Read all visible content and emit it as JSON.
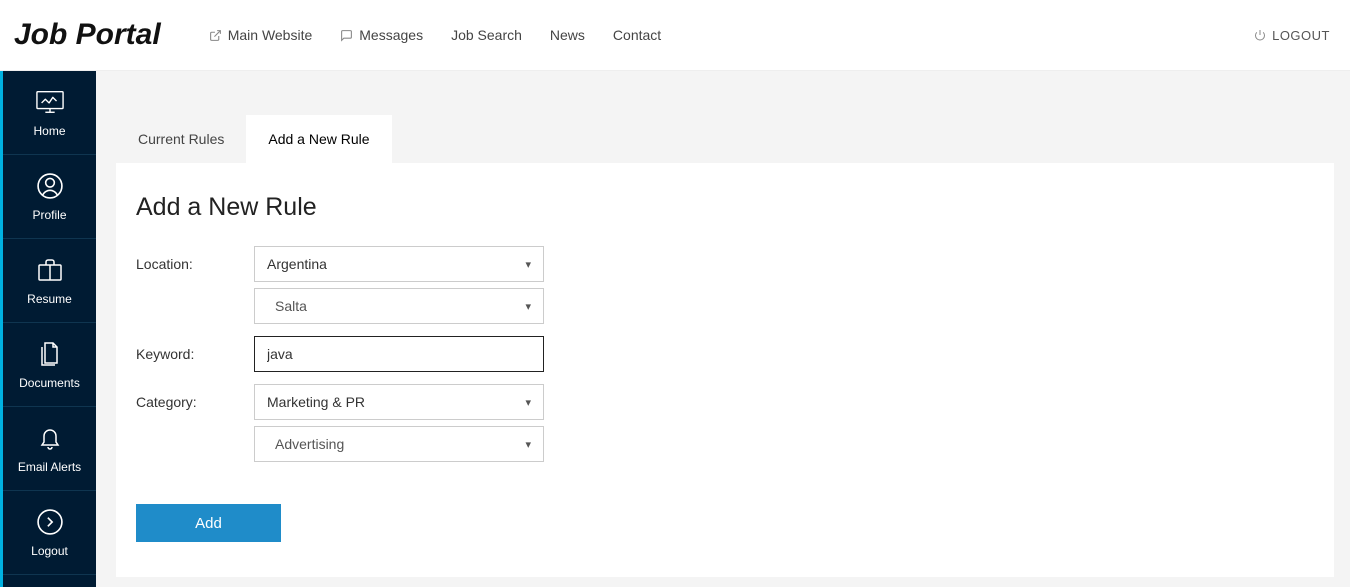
{
  "header": {
    "logo": "Job Portal",
    "nav": [
      {
        "label": "Main Website",
        "icon": "external-link-icon"
      },
      {
        "label": "Messages",
        "icon": "message-icon"
      },
      {
        "label": "Job Search",
        "icon": ""
      },
      {
        "label": "News",
        "icon": ""
      },
      {
        "label": "Contact",
        "icon": ""
      }
    ],
    "logout_label": "LOGOUT"
  },
  "sidebar": {
    "items": [
      {
        "label": "Home"
      },
      {
        "label": "Profile"
      },
      {
        "label": "Resume"
      },
      {
        "label": "Documents"
      },
      {
        "label": "Email Alerts"
      },
      {
        "label": "Logout"
      }
    ]
  },
  "tabs": {
    "items": [
      {
        "label": "Current Rules"
      },
      {
        "label": "Add a New Rule"
      }
    ],
    "active_index": 1
  },
  "form": {
    "title": "Add a New Rule",
    "location_label": "Location:",
    "location_country": "Argentina",
    "location_region": "Salta",
    "keyword_label": "Keyword:",
    "keyword_value": "java",
    "category_label": "Category:",
    "category_main": "Marketing & PR",
    "category_sub": "Advertising",
    "submit_label": "Add"
  }
}
